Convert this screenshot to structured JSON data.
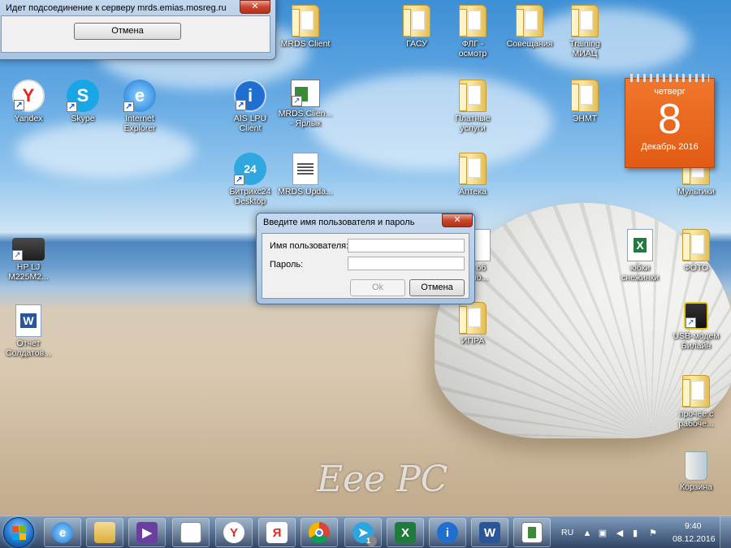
{
  "desktop_icons": {
    "yandex": "Yandex",
    "skype": "Skype",
    "ie": "Internet Explorer",
    "ie_line1": "Internet",
    "ie_line2": "Explorer",
    "hp_line1": "HP LJ",
    "hp_line2": "M225M2...",
    "report_line1": "Отчет",
    "report_line2": "Солдатов...",
    "mrds_client": "MRDS Client",
    "ais_line1": "AIS LPU",
    "ais_line2": "Client",
    "mrds_shortcut_line1": "MRDS.Clien...",
    "mrds_shortcut_line2": "- Ярлык",
    "bitrix_line1": "Битрикс24",
    "bitrix_line2": "Desktop",
    "mrds_update": "MRDS.Upda...",
    "gasu": "ГАСУ",
    "flg_line1": "ФЛГ -",
    "flg_line2": "осмотр",
    "meetings": "Совещания",
    "training_line1": "Training",
    "training_line2": "МИАЦ",
    "paid_line1": "Платные",
    "paid_line2": "услуги",
    "enmt": "ЭНМТ",
    "pharmacy": "Аптека",
    "hidden_line1": "е об",
    "hidden_line2": "дно...",
    "ipra": "ИПРА",
    "skirts_line1": "юбки",
    "skirts_line2": "снежинки",
    "cartoons": "Мультики",
    "photo": "ФОТО",
    "usb_line1": "USB-модем",
    "usb_line2": "Билайн",
    "other_line1": "прочее с",
    "other_line2": "рабоче...",
    "recycle": "Корзина"
  },
  "calendar": {
    "weekday": "четверг",
    "day": "8",
    "month_year": "Декабрь 2016"
  },
  "connect_window": {
    "title": "Идет подсоединение к серверу mrds.emias.mosreg.ru",
    "close": "✕",
    "cancel": "Отмена"
  },
  "login_dialog": {
    "title": "Введите имя пользователя и пароль",
    "close": "✕",
    "username_label": "Имя пользователя:",
    "username_value": "",
    "password_label": "Пароль:",
    "password_value": "",
    "ok": "Ok",
    "cancel": "Отмена"
  },
  "watermark": "Eee PC",
  "taskbar": {
    "yandex_letter": "Y",
    "yandex_browser_letter": "Я",
    "excel_letter": "X",
    "word_letter": "W",
    "telegram_badge": "1",
    "language": "RU",
    "time": "9:40",
    "date": "08.12.2016"
  },
  "colors": {
    "calendar_orange": "#e25b14",
    "taskbar_blue": "#283e5f",
    "close_red": "#c9452b"
  }
}
